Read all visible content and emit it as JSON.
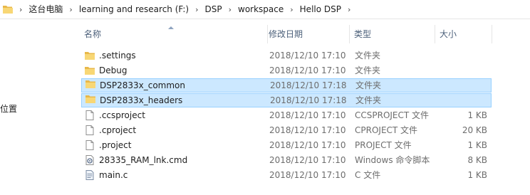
{
  "breadcrumb": {
    "segments": [
      "这台电脑",
      "learning and research (F:)",
      "DSP",
      "workspace",
      "Hello DSP"
    ]
  },
  "nav": {
    "partial_label": "位置"
  },
  "columns": {
    "name": "名称",
    "date": "修改日期",
    "type": "类型",
    "size": "大小"
  },
  "files": [
    {
      "name": ".settings",
      "date": "2018/12/10 17:10",
      "type": "文件夹",
      "size": "",
      "icon": "folder-icon",
      "selected": false
    },
    {
      "name": "Debug",
      "date": "2018/12/10 17:10",
      "type": "文件夹",
      "size": "",
      "icon": "folder-icon",
      "selected": false
    },
    {
      "name": "DSP2833x_common",
      "date": "2018/12/10 17:18",
      "type": "文件夹",
      "size": "",
      "icon": "folder-icon",
      "selected": true
    },
    {
      "name": "DSP2833x_headers",
      "date": "2018/12/10 17:18",
      "type": "文件夹",
      "size": "",
      "icon": "folder-icon",
      "selected": true
    },
    {
      "name": ".ccsproject",
      "date": "2018/12/10 17:10",
      "type": "CCSPROJECT 文件",
      "size": "1 KB",
      "icon": "file-icon",
      "selected": false
    },
    {
      "name": ".cproject",
      "date": "2018/12/10 17:10",
      "type": "CPROJECT 文件",
      "size": "20 KB",
      "icon": "file-icon",
      "selected": false
    },
    {
      "name": ".project",
      "date": "2018/12/10 17:10",
      "type": "PROJECT 文件",
      "size": "1 KB",
      "icon": "file-icon",
      "selected": false
    },
    {
      "name": "28335_RAM_lnk.cmd",
      "date": "2018/12/10 17:10",
      "type": "Windows 命令脚本",
      "size": "8 KB",
      "icon": "cmd-script-icon",
      "selected": false
    },
    {
      "name": "main.c",
      "date": "2018/12/10 17:10",
      "type": "C 文件",
      "size": "1 KB",
      "icon": "c-file-icon",
      "selected": false
    }
  ],
  "colors": {
    "selection_bg": "#cce8ff",
    "selection_border": "#99d1ff",
    "folder": "#f8d775",
    "header_text": "#4c607a"
  }
}
